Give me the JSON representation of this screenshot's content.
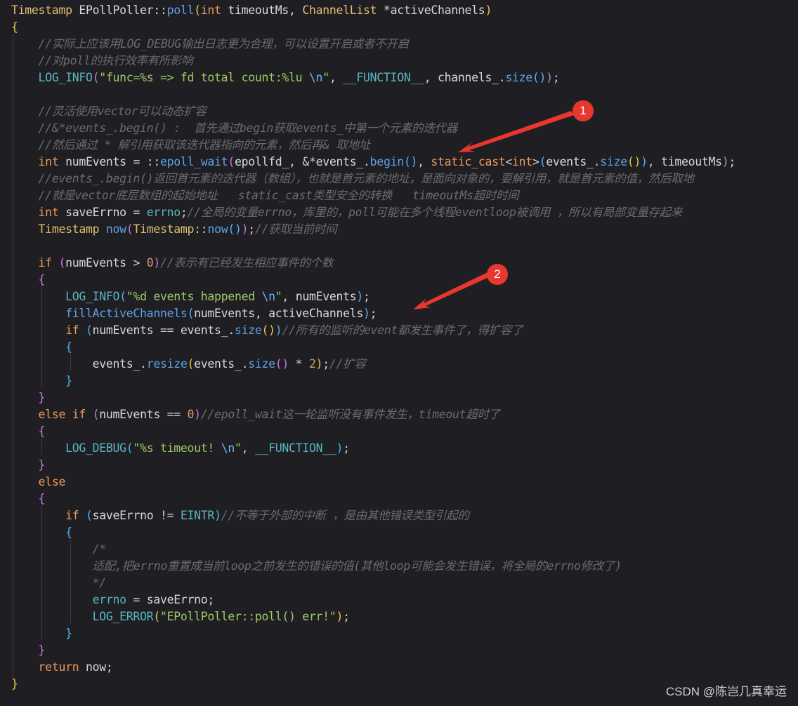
{
  "code": [
    [
      [
        "typ",
        "Timestamp "
      ],
      [
        "id",
        "EPollPoller"
      ],
      [
        "pun",
        "::"
      ],
      [
        "fn",
        "poll"
      ],
      [
        "b0",
        "("
      ],
      [
        "kw",
        "int"
      ],
      [
        "id",
        " timeoutMs, "
      ],
      [
        "typ",
        "ChannelList "
      ],
      [
        "pun",
        "*"
      ],
      [
        "id",
        "activeChannels"
      ],
      [
        "b0",
        ")"
      ]
    ],
    [
      [
        "b0",
        "{"
      ]
    ],
    [
      [
        "pun",
        "    "
      ],
      [
        "com",
        "//实际上应该用LOG_DEBUG输出日志更为合理，可以设置开启或者不开启"
      ]
    ],
    [
      [
        "pun",
        "    "
      ],
      [
        "com",
        "//对poll的执行效率有所影响"
      ]
    ],
    [
      [
        "pun",
        "    "
      ],
      [
        "mac",
        "LOG_INFO"
      ],
      [
        "b1",
        "("
      ],
      [
        "str",
        "\"func=%s => fd total count:%lu "
      ],
      [
        "esc",
        "\\n"
      ],
      [
        "str",
        "\""
      ],
      [
        "pun",
        ", "
      ],
      [
        "mac",
        "__FUNCTION__"
      ],
      [
        "pun",
        ", "
      ],
      [
        "id",
        "channels_"
      ],
      [
        "pun",
        "."
      ],
      [
        "fn",
        "size"
      ],
      [
        "b2",
        "()"
      ],
      [
        "b1",
        ")"
      ],
      [
        "pun",
        ";"
      ]
    ],
    [],
    [
      [
        "pun",
        "    "
      ],
      [
        "com",
        "//灵活使用vector可以动态扩容"
      ]
    ],
    [
      [
        "pun",
        "    "
      ],
      [
        "com",
        "//&*events_.begin() :  首先通过begin获取events_中第一个元素的迭代器"
      ]
    ],
    [
      [
        "pun",
        "    "
      ],
      [
        "com",
        "//然后通过 * 解引用获取该迭代器指向的元素，然后再& 取地址"
      ]
    ],
    [
      [
        "pun",
        "    "
      ],
      [
        "kw",
        "int"
      ],
      [
        "id",
        " numEvents "
      ],
      [
        "pun",
        "= ::"
      ],
      [
        "fn",
        "epoll_wait"
      ],
      [
        "b1",
        "("
      ],
      [
        "id",
        "epollfd_"
      ],
      [
        "pun",
        ", &*"
      ],
      [
        "id",
        "events_"
      ],
      [
        "pun",
        "."
      ],
      [
        "fn",
        "begin"
      ],
      [
        "b2",
        "()"
      ],
      [
        "pun",
        ", "
      ],
      [
        "kw",
        "static_cast"
      ],
      [
        "pun",
        "<"
      ],
      [
        "kw",
        "int"
      ],
      [
        "pun",
        ">"
      ],
      [
        "b2",
        "("
      ],
      [
        "id",
        "events_"
      ],
      [
        "pun",
        "."
      ],
      [
        "fn",
        "size"
      ],
      [
        "b0",
        "()"
      ],
      [
        "b2",
        ")"
      ],
      [
        "pun",
        ", "
      ],
      [
        "id",
        "timeoutMs"
      ],
      [
        "b1",
        ")"
      ],
      [
        "pun",
        ";"
      ]
    ],
    [
      [
        "pun",
        "    "
      ],
      [
        "com",
        "//events_.begin()返回首元素的迭代器（数组），也就是首元素的地址，是面向对象的，要解引用，就是首元素的值，然后取地"
      ]
    ],
    [
      [
        "pun",
        "    "
      ],
      [
        "com",
        "//就是vector底层数组的起始地址   static_cast类型安全的转换   timeoutMs超时时间"
      ]
    ],
    [
      [
        "pun",
        "    "
      ],
      [
        "kw",
        "int"
      ],
      [
        "id",
        " saveErrno "
      ],
      [
        "pun",
        "= "
      ],
      [
        "mac",
        "errno"
      ],
      [
        "pun",
        ";"
      ],
      [
        "com",
        "//全局的变量errno，库里的，poll可能在多个线程eventloop被调用 ，所以有局部变量存起来"
      ]
    ],
    [
      [
        "pun",
        "    "
      ],
      [
        "typ",
        "Timestamp "
      ],
      [
        "fn",
        "now"
      ],
      [
        "b1",
        "("
      ],
      [
        "typ",
        "Timestamp"
      ],
      [
        "pun",
        "::"
      ],
      [
        "fn",
        "now"
      ],
      [
        "b2",
        "()"
      ],
      [
        "b1",
        ")"
      ],
      [
        "pun",
        ";"
      ],
      [
        "com",
        "//获取当前时间"
      ]
    ],
    [],
    [
      [
        "pun",
        "    "
      ],
      [
        "kw",
        "if"
      ],
      [
        "pun",
        " "
      ],
      [
        "b1",
        "("
      ],
      [
        "id",
        "numEvents "
      ],
      [
        "pun",
        "> "
      ],
      [
        "num",
        "0"
      ],
      [
        "b1",
        ")"
      ],
      [
        "com",
        "//表示有已经发生相应事件的个数"
      ]
    ],
    [
      [
        "pun",
        "    "
      ],
      [
        "b1",
        "{"
      ]
    ],
    [
      [
        "pun",
        "        "
      ],
      [
        "mac",
        "LOG_INFO"
      ],
      [
        "b2",
        "("
      ],
      [
        "str",
        "\"%d events happened "
      ],
      [
        "esc",
        "\\n"
      ],
      [
        "str",
        "\""
      ],
      [
        "pun",
        ", "
      ],
      [
        "id",
        "numEvents"
      ],
      [
        "b2",
        ")"
      ],
      [
        "pun",
        ";"
      ]
    ],
    [
      [
        "pun",
        "        "
      ],
      [
        "fn",
        "fillActiveChannels"
      ],
      [
        "b2",
        "("
      ],
      [
        "id",
        "numEvents, activeChannels"
      ],
      [
        "b2",
        ")"
      ],
      [
        "pun",
        ";"
      ]
    ],
    [
      [
        "pun",
        "        "
      ],
      [
        "kw",
        "if"
      ],
      [
        "pun",
        " "
      ],
      [
        "b2",
        "("
      ],
      [
        "id",
        "numEvents "
      ],
      [
        "pun",
        "== "
      ],
      [
        "id",
        "events_"
      ],
      [
        "pun",
        "."
      ],
      [
        "fn",
        "size"
      ],
      [
        "b0",
        "()"
      ],
      [
        "b2",
        ")"
      ],
      [
        "com",
        "//所有的监听的event都发生事件了，得扩容了"
      ]
    ],
    [
      [
        "pun",
        "        "
      ],
      [
        "b2",
        "{"
      ]
    ],
    [
      [
        "pun",
        "            "
      ],
      [
        "id",
        "events_"
      ],
      [
        "pun",
        "."
      ],
      [
        "fn",
        "resize"
      ],
      [
        "b0",
        "("
      ],
      [
        "id",
        "events_"
      ],
      [
        "pun",
        "."
      ],
      [
        "fn",
        "size"
      ],
      [
        "b1",
        "()"
      ],
      [
        "pun",
        " * "
      ],
      [
        "num",
        "2"
      ],
      [
        "b0",
        ")"
      ],
      [
        "pun",
        ";"
      ],
      [
        "com",
        "//扩容"
      ]
    ],
    [
      [
        "pun",
        "        "
      ],
      [
        "b2",
        "}"
      ]
    ],
    [
      [
        "pun",
        "    "
      ],
      [
        "b1",
        "}"
      ]
    ],
    [
      [
        "pun",
        "    "
      ],
      [
        "kw",
        "else if"
      ],
      [
        "pun",
        " "
      ],
      [
        "b1",
        "("
      ],
      [
        "id",
        "numEvents "
      ],
      [
        "pun",
        "== "
      ],
      [
        "num",
        "0"
      ],
      [
        "b1",
        ")"
      ],
      [
        "com",
        "//epoll_wait这一轮监听没有事件发生，timeout超时了"
      ]
    ],
    [
      [
        "pun",
        "    "
      ],
      [
        "b1",
        "{"
      ]
    ],
    [
      [
        "pun",
        "        "
      ],
      [
        "mac",
        "LOG_DEBUG"
      ],
      [
        "b2",
        "("
      ],
      [
        "str",
        "\"%s timeout! "
      ],
      [
        "esc",
        "\\n"
      ],
      [
        "str",
        "\""
      ],
      [
        "pun",
        ", "
      ],
      [
        "mac",
        "__FUNCTION__"
      ],
      [
        "b2",
        ")"
      ],
      [
        "pun",
        ";"
      ]
    ],
    [
      [
        "pun",
        "    "
      ],
      [
        "b1",
        "}"
      ]
    ],
    [
      [
        "pun",
        "    "
      ],
      [
        "kw",
        "else"
      ]
    ],
    [
      [
        "pun",
        "    "
      ],
      [
        "b1",
        "{"
      ]
    ],
    [
      [
        "pun",
        "        "
      ],
      [
        "kw",
        "if"
      ],
      [
        "pun",
        " "
      ],
      [
        "b2",
        "("
      ],
      [
        "id",
        "saveErrno "
      ],
      [
        "pun",
        "!= "
      ],
      [
        "mac",
        "EINTR"
      ],
      [
        "b2",
        ")"
      ],
      [
        "com",
        "//不等于外部的中断 ，是由其他错误类型引起的"
      ]
    ],
    [
      [
        "pun",
        "        "
      ],
      [
        "b2",
        "{"
      ]
    ],
    [
      [
        "pun",
        "            "
      ],
      [
        "com",
        "/*"
      ]
    ],
    [
      [
        "pun",
        "            "
      ],
      [
        "com",
        "适配,把errno重置成当前loop之前发生的错误的值(其他loop可能会发生错误，将全局的errno修改了)"
      ]
    ],
    [
      [
        "pun",
        "            "
      ],
      [
        "com",
        "*/"
      ]
    ],
    [
      [
        "pun",
        "            "
      ],
      [
        "mac",
        "errno"
      ],
      [
        "pun",
        " = "
      ],
      [
        "id",
        "saveErrno"
      ],
      [
        "pun",
        ";"
      ]
    ],
    [
      [
        "pun",
        "            "
      ],
      [
        "mac",
        "LOG_ERROR"
      ],
      [
        "b0",
        "("
      ],
      [
        "str",
        "\"EPollPoller::poll() err!\""
      ],
      [
        "b0",
        ")"
      ],
      [
        "pun",
        ";"
      ]
    ],
    [
      [
        "pun",
        "        "
      ],
      [
        "b2",
        "}"
      ]
    ],
    [
      [
        "pun",
        "    "
      ],
      [
        "b1",
        "}"
      ]
    ],
    [
      [
        "pun",
        "    "
      ],
      [
        "kw",
        "return"
      ],
      [
        "id",
        " now"
      ],
      [
        "pun",
        ";"
      ]
    ],
    [
      [
        "b0",
        "}"
      ]
    ]
  ],
  "annotations": [
    {
      "number": "1",
      "points_to_line": 10
    },
    {
      "number": "2",
      "points_to_line": 19
    }
  ],
  "watermark": "CSDN @陈岂几真幸运",
  "colors": {
    "background": "#1f1f23",
    "marker": "#e8372f",
    "comment": "#6a6a72",
    "string": "#9ec864",
    "keyword": "#ee9a52",
    "function": "#5ea0e6"
  }
}
